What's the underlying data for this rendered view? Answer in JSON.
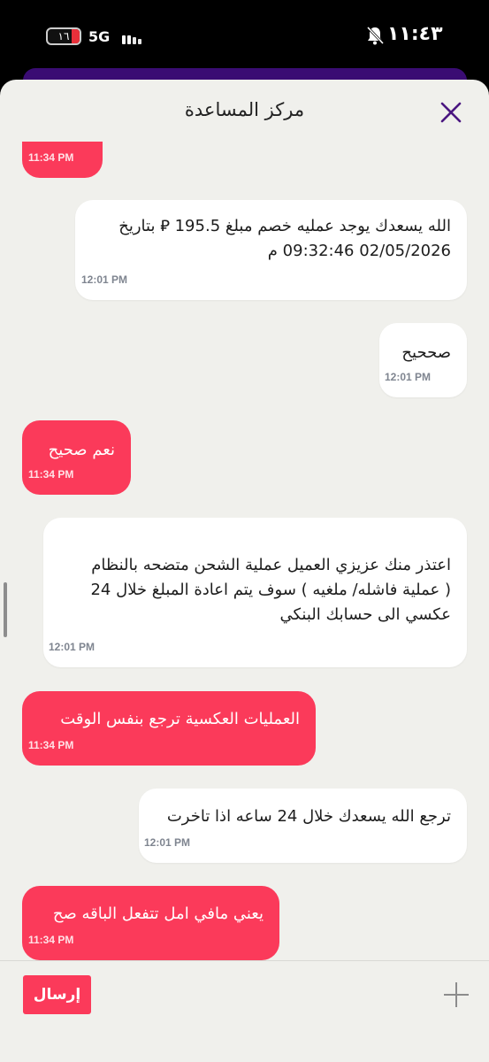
{
  "status_bar": {
    "battery_level": "١٦",
    "network": "5G",
    "time": "١١:٤٣"
  },
  "header": {
    "title": "مركز المساعدة"
  },
  "messages": [
    {
      "sender": "user",
      "text": "",
      "time": "11:34 PM"
    },
    {
      "sender": "agent",
      "text": "الله يسعدك يوجد عمليه خصم مبلغ 195.5 ⃁ بتاريخ\n02/05/2026 09:32:46 م",
      "time": "12:01 PM"
    },
    {
      "sender": "agent",
      "text": "صححيح",
      "time": "12:01 PM"
    },
    {
      "sender": "user",
      "text": "نعم صحيح",
      "time": "11:34 PM"
    },
    {
      "sender": "agent",
      "text": "اعتذر منك عزيزي العميل عملية الشحن متضحه بالنظام\n( عملية فاشله/ ملغيه ) سوف يتم اعادة المبلغ خلال 24\nعكسي الى حسابك البنكي",
      "time": "12:01 PM"
    },
    {
      "sender": "user",
      "text": "العمليات العكسية ترجع بنفس الوقت",
      "time": "11:34 PM"
    },
    {
      "sender": "agent",
      "text": "ترجع الله يسعدك خلال 24 ساعه اذا تاخرت",
      "time": "12:01 PM"
    },
    {
      "sender": "user",
      "text": "يعني مافي امل تتفعل الباقه صح",
      "time": "11:34 PM"
    }
  ],
  "composer": {
    "send_label": "إرسال"
  },
  "icons": {
    "close": "close-icon",
    "attach": "plus-icon",
    "mute": "bell-off-icon"
  },
  "colors": {
    "accent": "#fb3a5a",
    "brand_purple": "#3a0c73",
    "background": "#f0f0ec"
  }
}
